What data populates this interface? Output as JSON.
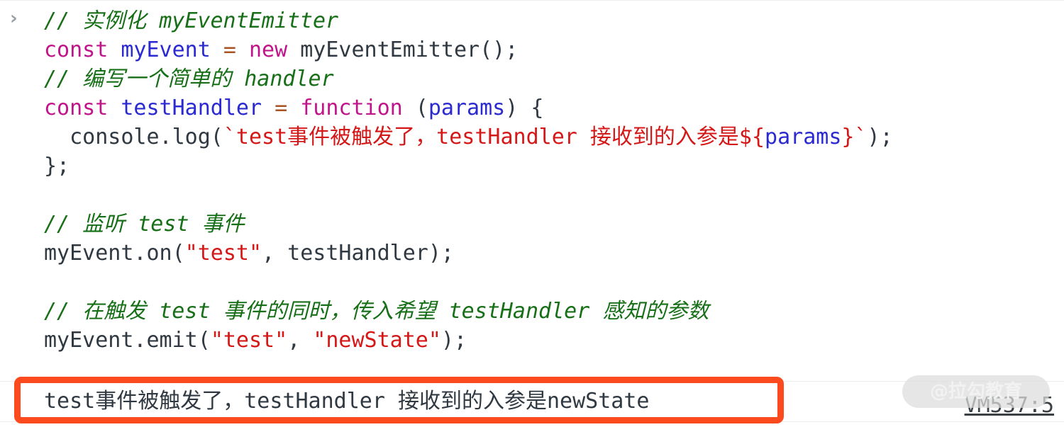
{
  "console": {
    "prompt_symbol": "›",
    "code_lines": [
      [
        {
          "t": "comment",
          "s": "// 实例化 myEventEmitter"
        }
      ],
      [
        {
          "t": "keyword",
          "s": "const"
        },
        {
          "t": "plain",
          "s": " "
        },
        {
          "t": "var",
          "s": "myEvent"
        },
        {
          "t": "plain",
          "s": " "
        },
        {
          "t": "op",
          "s": "="
        },
        {
          "t": "plain",
          "s": " "
        },
        {
          "t": "keyword",
          "s": "new"
        },
        {
          "t": "plain",
          "s": " myEventEmitter();"
        }
      ],
      [
        {
          "t": "comment",
          "s": "// 编写一个简单的 handler"
        }
      ],
      [
        {
          "t": "keyword",
          "s": "const"
        },
        {
          "t": "plain",
          "s": " "
        },
        {
          "t": "var",
          "s": "testHandler"
        },
        {
          "t": "plain",
          "s": " "
        },
        {
          "t": "op",
          "s": "="
        },
        {
          "t": "plain",
          "s": " "
        },
        {
          "t": "keyword",
          "s": "function"
        },
        {
          "t": "plain",
          "s": " ("
        },
        {
          "t": "var",
          "s": "params"
        },
        {
          "t": "plain",
          "s": ") {"
        }
      ],
      [
        {
          "t": "plain",
          "s": "  console.log("
        },
        {
          "t": "string",
          "s": "`test事件被触发了，testHandler 接收到的入参是${"
        },
        {
          "t": "var",
          "s": "params"
        },
        {
          "t": "string",
          "s": "}`"
        },
        {
          "t": "plain",
          "s": ");"
        }
      ],
      [
        {
          "t": "plain",
          "s": "};"
        }
      ],
      [
        {
          "t": "blank",
          "s": " "
        }
      ],
      [
        {
          "t": "comment",
          "s": "// 监听 test 事件"
        }
      ],
      [
        {
          "t": "plain",
          "s": "myEvent.on("
        },
        {
          "t": "string",
          "s": "\"test\""
        },
        {
          "t": "plain",
          "s": ", testHandler);"
        }
      ],
      [
        {
          "t": "blank",
          "s": " "
        }
      ],
      [
        {
          "t": "comment",
          "s": "// 在触发 test 事件的同时，传入希望 testHandler 感知的参数"
        }
      ],
      [
        {
          "t": "plain",
          "s": "myEvent.emit("
        },
        {
          "t": "string",
          "s": "\"test\""
        },
        {
          "t": "plain",
          "s": ", "
        },
        {
          "t": "string",
          "s": "\"newState\""
        },
        {
          "t": "plain",
          "s": ");"
        }
      ]
    ],
    "output": {
      "text": "test事件被触发了，testHandler 接收到的入参是newState",
      "source_link": "VM537:5"
    },
    "annotation": {
      "color": "#fb4a1e"
    },
    "watermark": {
      "text": "@拉勾教育"
    }
  }
}
